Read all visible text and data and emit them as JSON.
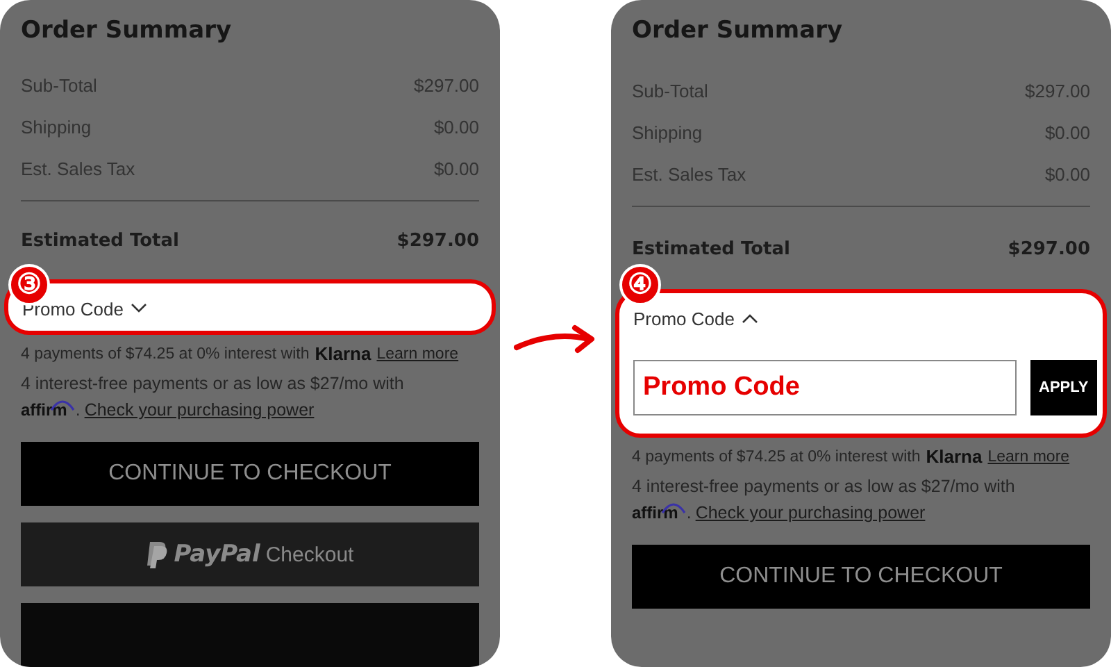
{
  "panels": [
    {
      "step": "③",
      "title": "Order Summary",
      "lines": [
        {
          "label": "Sub-Total",
          "value": "$297.00"
        },
        {
          "label": "Shipping",
          "value": "$0.00"
        },
        {
          "label": "Est. Sales Tax",
          "value": "$0.00"
        }
      ],
      "total": {
        "label": "Estimated Total",
        "value": "$297.00"
      },
      "promo": {
        "label": "Promo Code",
        "expanded": false
      },
      "klarna": {
        "text": "4 payments of $74.25 at 0% interest with",
        "brand": "Klarna",
        "link": "Learn more"
      },
      "affirm": {
        "text": "4 interest-free payments or as low as $27/mo with",
        "brand": "affirm",
        "suffix": ".",
        "link": "Check your purchasing power"
      },
      "buttons": [
        {
          "kind": "checkout",
          "label": "CONTINUE TO CHECKOUT"
        },
        {
          "kind": "paypal",
          "brand": "PayPal",
          "label": "Checkout"
        },
        {
          "kind": "blank"
        }
      ]
    },
    {
      "step": "④",
      "title": "Order Summary",
      "lines": [
        {
          "label": "Sub-Total",
          "value": "$297.00"
        },
        {
          "label": "Shipping",
          "value": "$0.00"
        },
        {
          "label": "Est. Sales Tax",
          "value": "$0.00"
        }
      ],
      "total": {
        "label": "Estimated Total",
        "value": "$297.00"
      },
      "promo": {
        "label": "Promo Code",
        "expanded": true,
        "value": "Promo Code",
        "button": "APPLY"
      },
      "klarna": {
        "text": "4 payments of $74.25 at 0% interest with",
        "brand": "Klarna",
        "link": "Learn more"
      },
      "affirm": {
        "text": "4 interest-free payments or as low as $27/mo with",
        "brand": "affirm",
        "suffix": ".",
        "link": "Check your purchasing power"
      },
      "buttons": [
        {
          "kind": "checkout",
          "label": "CONTINUE TO CHECKOUT"
        }
      ]
    }
  ]
}
